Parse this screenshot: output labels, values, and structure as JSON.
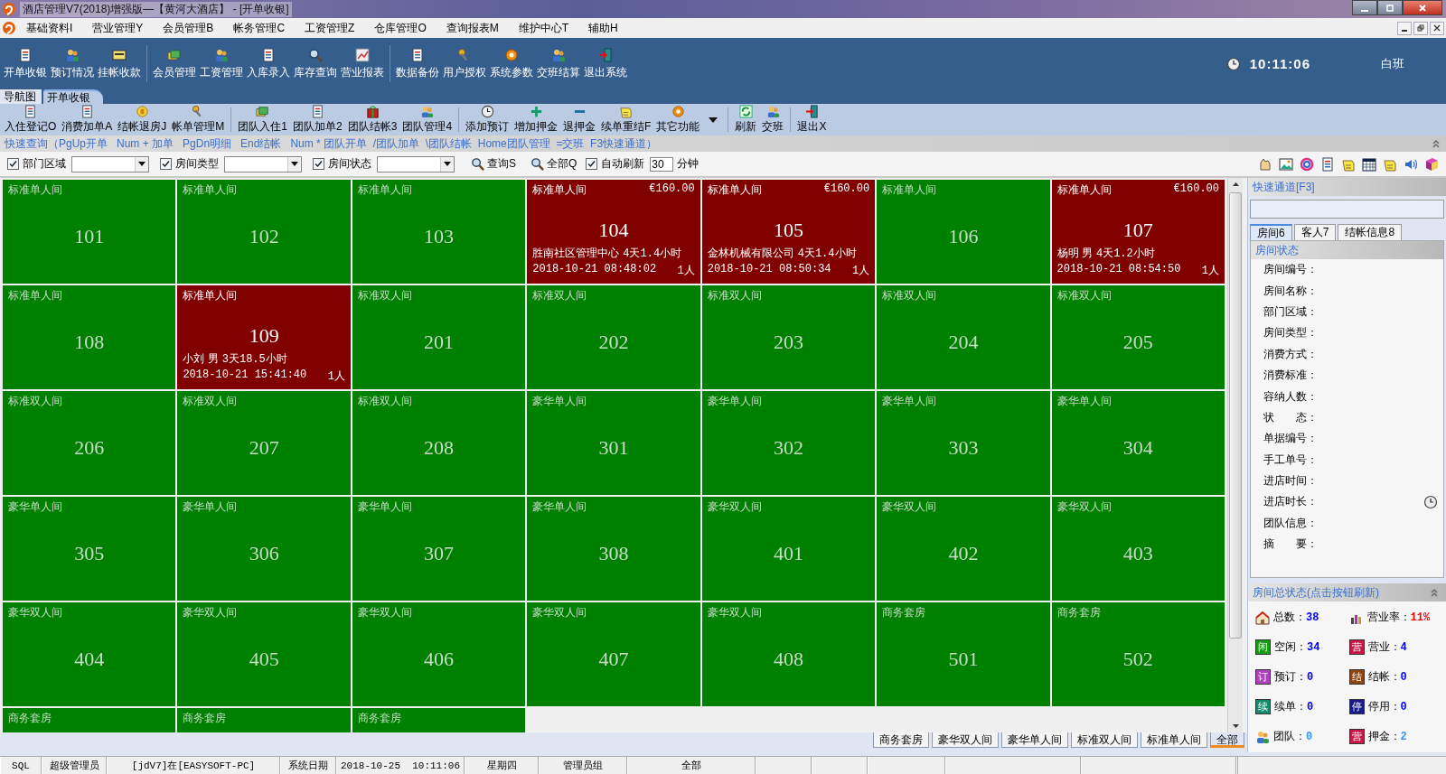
{
  "window": {
    "title": "酒店管理V7(2018)增强版—【黄河大酒店】 - [开单收银]"
  },
  "menu": [
    "基础资料I",
    "营业管理Y",
    "会员管理B",
    "帐务管理C",
    "工资管理Z",
    "仓库管理O",
    "查询报表M",
    "维护中心T",
    "辅助H"
  ],
  "main_toolbar": {
    "groups": [
      [
        "开单收银",
        "预订情况",
        "挂帐收款"
      ],
      [
        "会员管理",
        "工资管理",
        "入库录入",
        "库存查询",
        "营业报表"
      ],
      [
        "数据备份",
        "用户授权",
        "系统参数",
        "交班结算",
        "退出系统"
      ]
    ],
    "clock": "10:11:06",
    "shift": "白班"
  },
  "tabs": [
    {
      "label": "导航图",
      "selected": false
    },
    {
      "label": "开单收银",
      "selected": true
    }
  ],
  "action_toolbar": {
    "groups": [
      [
        "入住登记O",
        "消费加单A",
        "结帐退房J",
        "帐单管理M"
      ],
      [
        "团队入住1",
        "团队加单2",
        "团队结帐3",
        "团队管理4"
      ],
      [
        "添加预订",
        "增加押金",
        "退押金",
        "续单重结F",
        "其它功能"
      ],
      [
        "刷新",
        "交班"
      ],
      [
        "退出X"
      ]
    ]
  },
  "shortcuts": "快速查询（PgUp开单   Num + 加单   PgDn明细   End结帐   Num * 团队开单  /团队加单  \\团队结帐  Home团队管理  =交班  F3快速通道）",
  "filters": [
    {
      "label": "部门区域",
      "checked": true
    },
    {
      "label": "房间类型",
      "checked": true
    },
    {
      "label": "房间状态",
      "checked": true
    }
  ],
  "filter_buttons": [
    "查询S",
    "全部Q"
  ],
  "auto_refresh": {
    "label": "自动刷新",
    "checked": true,
    "value": "30",
    "unit": "分钟"
  },
  "rooms": [
    {
      "type": "标准单人间",
      "number": "101",
      "occupied": false
    },
    {
      "type": "标准单人间",
      "number": "102",
      "occupied": false
    },
    {
      "type": "标准单人间",
      "number": "103",
      "occupied": false
    },
    {
      "type": "标准单人间",
      "number": "104",
      "occupied": true,
      "price": "€160.00",
      "guest": "胜南社区管理中心",
      "duration": "4天1.4小时",
      "checkin": "2018-10-21 08:48:02",
      "persons": "1人"
    },
    {
      "type": "标准单人间",
      "number": "105",
      "occupied": true,
      "price": "€160.00",
      "guest": "金林机械有限公司",
      "duration": "4天1.4小时",
      "checkin": "2018-10-21 08:50:34",
      "persons": "1人"
    },
    {
      "type": "标准单人间",
      "number": "106",
      "occupied": false
    },
    {
      "type": "标准单人间",
      "number": "107",
      "occupied": true,
      "price": "€160.00",
      "guest": "杨明 男",
      "duration": "4天1.2小时",
      "checkin": "2018-10-21 08:54:50",
      "persons": "1人"
    },
    {
      "type": "标准单人间",
      "number": "108",
      "occupied": false
    },
    {
      "type": "标准单人间",
      "number": "109",
      "occupied": true,
      "guest": "小刘 男",
      "duration": "3天18.5小时",
      "checkin": "2018-10-21 15:41:40",
      "persons": "1人"
    },
    {
      "type": "标准双人间",
      "number": "201",
      "occupied": false
    },
    {
      "type": "标准双人间",
      "number": "202",
      "occupied": false
    },
    {
      "type": "标准双人间",
      "number": "203",
      "occupied": false
    },
    {
      "type": "标准双人间",
      "number": "204",
      "occupied": false
    },
    {
      "type": "标准双人间",
      "number": "205",
      "occupied": false
    },
    {
      "type": "标准双人间",
      "number": "206",
      "occupied": false
    },
    {
      "type": "标准双人间",
      "number": "207",
      "occupied": false
    },
    {
      "type": "标准双人间",
      "number": "208",
      "occupied": false
    },
    {
      "type": "豪华单人间",
      "number": "301",
      "occupied": false
    },
    {
      "type": "豪华单人间",
      "number": "302",
      "occupied": false
    },
    {
      "type": "豪华单人间",
      "number": "303",
      "occupied": false
    },
    {
      "type": "豪华单人间",
      "number": "304",
      "occupied": false
    },
    {
      "type": "豪华单人间",
      "number": "305",
      "occupied": false
    },
    {
      "type": "豪华单人间",
      "number": "306",
      "occupied": false
    },
    {
      "type": "豪华单人间",
      "number": "307",
      "occupied": false
    },
    {
      "type": "豪华单人间",
      "number": "308",
      "occupied": false
    },
    {
      "type": "豪华双人间",
      "number": "401",
      "occupied": false
    },
    {
      "type": "豪华双人间",
      "number": "402",
      "occupied": false
    },
    {
      "type": "豪华双人间",
      "number": "403",
      "occupied": false
    },
    {
      "type": "豪华双人间",
      "number": "404",
      "occupied": false
    },
    {
      "type": "豪华双人间",
      "number": "405",
      "occupied": false
    },
    {
      "type": "豪华双人间",
      "number": "406",
      "occupied": false
    },
    {
      "type": "豪华双人间",
      "number": "407",
      "occupied": false
    },
    {
      "type": "豪华双人间",
      "number": "408",
      "occupied": false
    },
    {
      "type": "商务套房",
      "number": "501",
      "occupied": false
    },
    {
      "type": "商务套房",
      "number": "502",
      "occupied": false
    },
    {
      "type": "商务套房",
      "occupied": false
    },
    {
      "type": "商务套房",
      "occupied": false
    },
    {
      "type": "商务套房",
      "occupied": false
    }
  ],
  "room_type_tabs": [
    {
      "label": "商务套房",
      "selected": false
    },
    {
      "label": "豪华双人间",
      "selected": false
    },
    {
      "label": "豪华单人间",
      "selected": false
    },
    {
      "label": "标准双人间",
      "selected": false
    },
    {
      "label": "标准单人间",
      "selected": false
    },
    {
      "label": "全部",
      "selected": true
    }
  ],
  "right_panel": {
    "quick_channel": "快速通道[F3]",
    "tabs": [
      {
        "label": "房间6",
        "selected": true
      },
      {
        "label": "客人7",
        "selected": false
      },
      {
        "label": "结帐信息8",
        "selected": false
      }
    ],
    "section": "房间状态",
    "fields": [
      "房间编号：",
      "房间名称：",
      "部门区域：",
      "房间类型：",
      "消费方式：",
      "消费标准：",
      "容纳人数：",
      "状　　态：",
      "单据编号：",
      "手工单号：",
      "进店时间：",
      "进店时长：",
      "团队信息：",
      "摘　　要："
    ],
    "summary_title": "房间总状态(点击按钮刷新)",
    "stats": [
      {
        "kind": "icon",
        "label": "总数：",
        "value": "38",
        "color": "#0000ff"
      },
      {
        "kind": "icon",
        "label": "营业率：",
        "value": "11%",
        "color": "#ff0000"
      },
      {
        "kind": "badge",
        "badge": "闲",
        "label": "空闲：",
        "value": "34",
        "color": "#0000ff"
      },
      {
        "kind": "badge",
        "badge": "营",
        "label": "营业：",
        "value": "4",
        "color": "#0000ff"
      },
      {
        "kind": "badge",
        "badge": "订",
        "label": "预订：",
        "value": "0",
        "color": "#0000ff"
      },
      {
        "kind": "badge",
        "badge": "结",
        "label": "结帐：",
        "value": "0",
        "color": "#0000ff"
      },
      {
        "kind": "badge",
        "badge": "续",
        "label": "续单：",
        "value": "0",
        "color": "#0000ff"
      },
      {
        "kind": "badge",
        "badge": "停",
        "label": "停用：",
        "value": "0",
        "color": "#0000ff"
      },
      {
        "kind": "icon",
        "label": "团队：",
        "value": "0",
        "color": "#3399ff"
      },
      {
        "kind": "badge",
        "badge": "营",
        "label": "押金：",
        "value": "2",
        "color": "#3399ff"
      }
    ]
  },
  "status_bar": [
    "SQL",
    "超级管理员",
    "[jdV7]在[EASYSOFT-PC]",
    "系统日期",
    "2018-10-25  10:11:06",
    "星期四",
    "管理员组",
    "全部"
  ]
}
